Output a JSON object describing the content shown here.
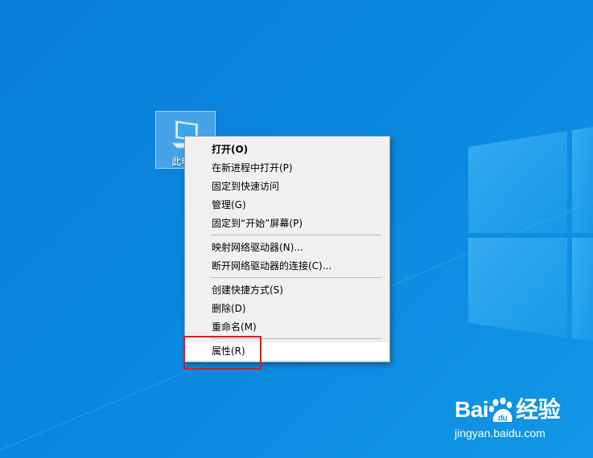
{
  "desktop": {
    "icon": {
      "label": "此电脑",
      "visible_label": "此电"
    }
  },
  "context_menu": {
    "groups": [
      [
        {
          "label": "打开(O)",
          "bold": true
        },
        {
          "label": "在新进程中打开(P)"
        },
        {
          "label": "固定到快速访问"
        },
        {
          "label": "管理(G)"
        },
        {
          "label": "固定到“开始”屏幕(P)"
        }
      ],
      [
        {
          "label": "映射网络驱动器(N)..."
        },
        {
          "label": "断开网络驱动器的连接(C)..."
        }
      ],
      [
        {
          "label": "创建快捷方式(S)"
        },
        {
          "label": "删除(D)"
        },
        {
          "label": "重命名(M)"
        }
      ],
      [
        {
          "label": "属性(R)",
          "hovered": true
        }
      ]
    ]
  },
  "annotation": {
    "color": "#e01b1b",
    "target": "属性(R)"
  },
  "watermark": {
    "logo_left": "Bai",
    "logo_right": "经验",
    "url": "jingyan.baidu.com",
    "paw_text": "du"
  }
}
